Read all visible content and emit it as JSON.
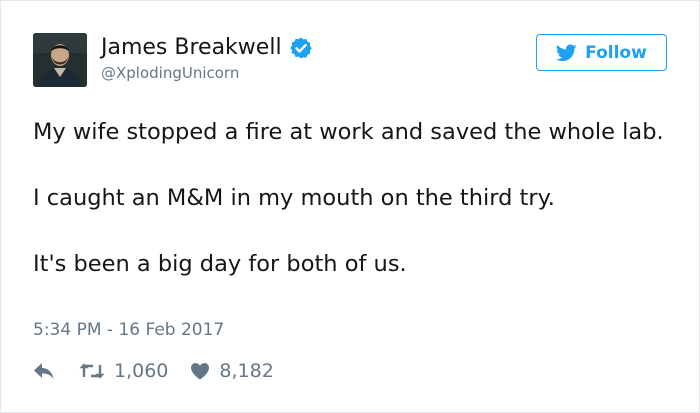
{
  "tweet": {
    "author": {
      "name": "James Breakwell",
      "handle": "@XplodingUnicorn",
      "verified": true
    },
    "follow_label": "Follow",
    "text_paragraphs": [
      "My wife stopped a fire at work and saved the whole lab.",
      "I caught an M&M in my mouth on the third try.",
      "It's been a big day for both of us."
    ],
    "timestamp": "5:34 PM - 16 Feb 2017",
    "stats": {
      "retweets": "1,060",
      "likes": "8,182"
    }
  },
  "icons": {
    "verified": "verified-badge-icon",
    "follow": "twitter-bird-icon",
    "reply": "reply-arrow-icon",
    "retweet": "retweet-icon",
    "like": "heart-icon"
  },
  "colors": {
    "brand": "#1da1f2",
    "text": "#14171a",
    "muted": "#657786",
    "border": "#e1e8ed"
  }
}
